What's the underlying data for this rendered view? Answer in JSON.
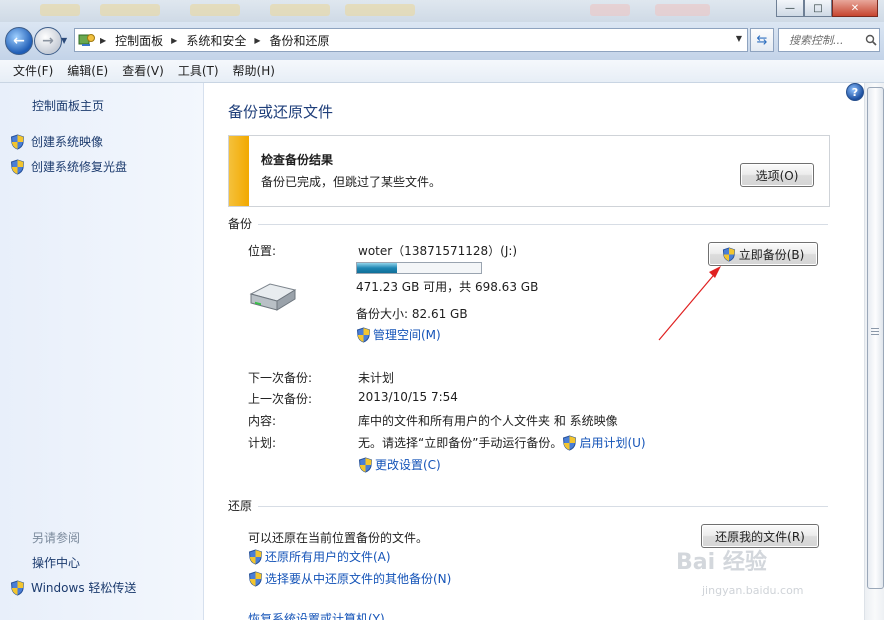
{
  "window": {
    "minimize_label": "—",
    "maximize_label": "□",
    "close_label": "✕"
  },
  "address": {
    "crumbs": [
      "控制面板",
      "系统和安全",
      "备份和还原"
    ],
    "search_placeholder": "搜索控制..."
  },
  "menu": [
    "文件(F)",
    "编辑(E)",
    "查看(V)",
    "工具(T)",
    "帮助(H)"
  ],
  "sidebar": {
    "home": "控制面板主页",
    "create_image": "创建系统映像",
    "create_repair_disc": "创建系统修复光盘",
    "see_also": "另请参阅",
    "action_center": "操作中心",
    "easy_transfer": "Windows 轻松传送"
  },
  "main": {
    "title": "备份或还原文件",
    "alert": {
      "title": "检查备份结果",
      "message": "备份已完成，但跳过了某些文件。",
      "options_button": "选项(O)"
    },
    "backup": {
      "section": "备份",
      "location_label": "位置:",
      "location_value": "woter（13871571128）(J:)",
      "usage_fraction": 0.325,
      "space": "471.23 GB 可用，共 698.63 GB",
      "size": "备份大小: 82.61 GB",
      "manage_space": "管理空间(M)",
      "backup_now_button": "立即备份(B)",
      "next_label": "下一次备份:",
      "next_value": "未计划",
      "last_label": "上一次备份:",
      "last_value": "2013/10/15 7:54",
      "contents_label": "内容:",
      "contents_value": "库中的文件和所有用户的个人文件夹 和 系统映像",
      "schedule_label": "计划:",
      "schedule_value": "无。请选择“立即备份”手动运行备份。",
      "enable_schedule": "启用计划(U)",
      "change_settings": "更改设置(C)"
    },
    "restore": {
      "section": "还原",
      "text": "可以还原在当前位置备份的文件。",
      "restore_button": "还原我的文件(R)",
      "restore_all_users": "还原所有用户的文件(A)",
      "select_other": "选择要从中还原文件的其他备份(N)",
      "recover_settings": "恢复系统设置或计算机(Y)"
    }
  },
  "watermark": {
    "logo_text": "Bai 经验",
    "url": "jingyan.baidu.com"
  },
  "colors": {
    "link": "#1554b8",
    "alert_accent": "#f2a900",
    "title": "#1e3e7a",
    "arrow": "#e02020"
  }
}
